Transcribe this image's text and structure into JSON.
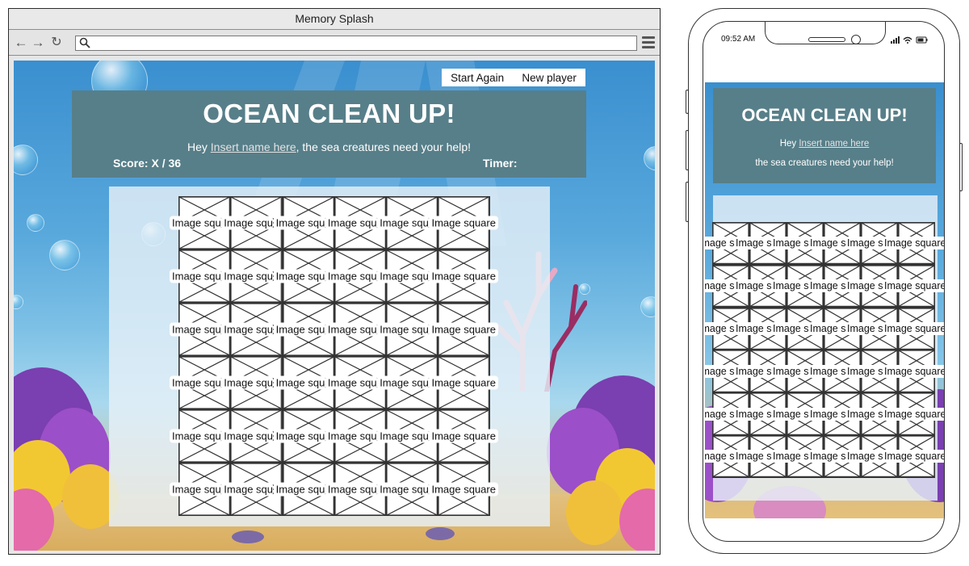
{
  "browser": {
    "window_title": "Memory Splash",
    "nav": {
      "back_icon": "arrow-left-icon",
      "forward_icon": "arrow-right-icon",
      "reload_icon": "reload-icon"
    },
    "address_value": "",
    "menu_icon": "hamburger-menu-icon"
  },
  "page": {
    "buttons": {
      "start_again": "Start Again",
      "new_player": "New player"
    },
    "title": "OCEAN CLEAN UP!",
    "greeting_prefix": "Hey ",
    "name_placeholder": "Insert name here",
    "greeting_suffix": ", the sea creatures need your help!",
    "score": "Score: X / 36",
    "timer": "Timer:",
    "grid": {
      "rows": 6,
      "cols": 6,
      "cell_label": "Image square"
    }
  },
  "mobile": {
    "status_time": "09:52 AM",
    "title": "OCEAN CLEAN UP!",
    "greeting_prefix": "Hey ",
    "name_placeholder": "Insert name here",
    "greeting_line2": "the sea creatures need your help!",
    "grid": {
      "rows": 6,
      "cols": 6,
      "cell_label": "Image square"
    }
  },
  "colors": {
    "header_panel": "#577f89",
    "ocean_top": "#3a8fcf",
    "sand": "#e5c07a"
  }
}
